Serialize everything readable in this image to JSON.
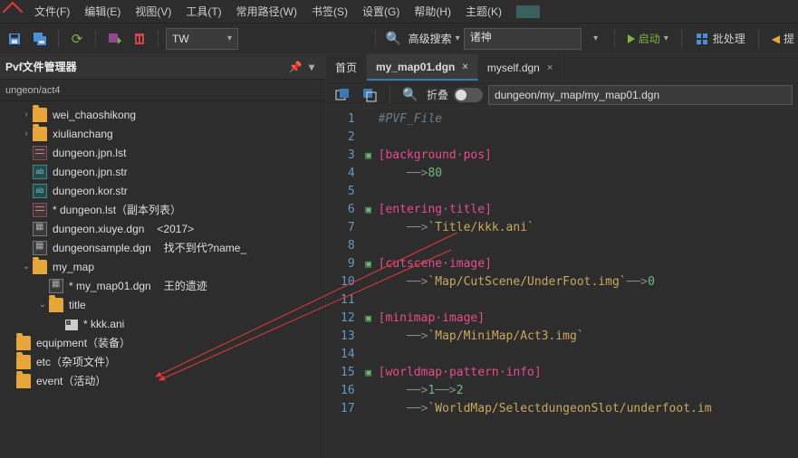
{
  "menu": {
    "items": [
      "文件(F)",
      "编辑(E)",
      "视图(V)",
      "工具(T)",
      "常用路径(W)",
      "书签(S)",
      "设置(G)",
      "帮助(H)",
      "主题(K)"
    ]
  },
  "toolbar": {
    "file_filter": "TW",
    "search_label": "高级搜索",
    "search_value": "诸神",
    "launch_label": "启动",
    "batch_label": "批处理",
    "prompt_label": "提"
  },
  "sidebar": {
    "title": "Pvf文件管理器",
    "crumb": "ungeon/act4",
    "tree": [
      {
        "indent": 1,
        "twisty": ">",
        "icon": "folder",
        "label": "wei_chaoshikong"
      },
      {
        "indent": 1,
        "twisty": ">",
        "icon": "folder",
        "label": "xiulianchang"
      },
      {
        "indent": 1,
        "twisty": "",
        "icon": "list",
        "label": "dungeon.jpn.lst"
      },
      {
        "indent": 1,
        "twisty": "",
        "icon": "str",
        "label": "dungeon.jpn.str"
      },
      {
        "indent": 1,
        "twisty": "",
        "icon": "str",
        "label": "dungeon.kor.str"
      },
      {
        "indent": 1,
        "twisty": "",
        "icon": "list",
        "label": "* dungeon.lst（副本列表）",
        "extra": ""
      },
      {
        "indent": 1,
        "twisty": "",
        "icon": "dgn",
        "label": "dungeon.xiuye.dgn",
        "extra": "<2017>"
      },
      {
        "indent": 1,
        "twisty": "",
        "icon": "dgn",
        "label": "dungeonsample.dgn",
        "extra": "找不到代?name_"
      },
      {
        "indent": 1,
        "twisty": "v",
        "icon": "folder",
        "label": "my_map"
      },
      {
        "indent": 2,
        "twisty": "",
        "icon": "dgn",
        "label": "* my_map01.dgn",
        "extra": "王的遗迹"
      },
      {
        "indent": 2,
        "twisty": "v",
        "icon": "folder",
        "label": "title"
      },
      {
        "indent": 3,
        "twisty": "",
        "icon": "ani",
        "label": "* kkk.ani"
      },
      {
        "indent": 0,
        "twisty": "",
        "icon": "folder",
        "label": "equipment（装备）"
      },
      {
        "indent": 0,
        "twisty": "",
        "icon": "folder",
        "label": "etc（杂项文件）"
      },
      {
        "indent": 0,
        "twisty": "",
        "icon": "folder",
        "label": "event（活动）"
      }
    ]
  },
  "editor": {
    "tabs": [
      {
        "label": "首页",
        "closable": false,
        "active": false
      },
      {
        "label": "my_map01.dgn",
        "closable": true,
        "active": true
      },
      {
        "label": "myself.dgn",
        "closable": true,
        "active": false
      }
    ],
    "fold_label": "折叠",
    "path": "dungeon/my_map/my_map01.dgn",
    "code": [
      {
        "n": 1,
        "tokens": [
          {
            "t": "tok-cmt",
            "v": "#PVF_File"
          }
        ]
      },
      {
        "n": 2,
        "tokens": []
      },
      {
        "n": 3,
        "fold": true,
        "tokens": [
          {
            "t": "tok-key",
            "v": "[background"
          },
          {
            "t": "tok-dot",
            "v": "·"
          },
          {
            "t": "tok-key",
            "v": "pos]"
          }
        ]
      },
      {
        "n": 4,
        "tokens": [
          {
            "t": "tok-arr",
            "v": "──>"
          },
          {
            "t": "tok-num",
            "v": "80"
          }
        ]
      },
      {
        "n": 5,
        "tokens": []
      },
      {
        "n": 6,
        "fold": true,
        "tokens": [
          {
            "t": "tok-key",
            "v": "[entering"
          },
          {
            "t": "tok-dot",
            "v": "·"
          },
          {
            "t": "tok-key",
            "v": "title]"
          }
        ]
      },
      {
        "n": 7,
        "tokens": [
          {
            "t": "tok-arr",
            "v": "──>"
          },
          {
            "t": "tok-str",
            "v": "`Title/kkk.ani`"
          }
        ]
      },
      {
        "n": 8,
        "tokens": []
      },
      {
        "n": 9,
        "fold": true,
        "tokens": [
          {
            "t": "tok-key",
            "v": "[cutscene"
          },
          {
            "t": "tok-dot",
            "v": "·"
          },
          {
            "t": "tok-key",
            "v": "image]"
          }
        ]
      },
      {
        "n": 10,
        "tokens": [
          {
            "t": "tok-arr",
            "v": "──>"
          },
          {
            "t": "tok-str",
            "v": "`Map/CutScene/UnderFoot.img`"
          },
          {
            "t": "tok-arr",
            "v": "──>"
          },
          {
            "t": "tok-num",
            "v": "0"
          }
        ]
      },
      {
        "n": 11,
        "tokens": []
      },
      {
        "n": 12,
        "fold": true,
        "tokens": [
          {
            "t": "tok-key",
            "v": "[minimap"
          },
          {
            "t": "tok-dot",
            "v": "·"
          },
          {
            "t": "tok-key",
            "v": "image]"
          }
        ]
      },
      {
        "n": 13,
        "tokens": [
          {
            "t": "tok-arr",
            "v": "──>"
          },
          {
            "t": "tok-str",
            "v": "`Map/MiniMap/Act3.img`"
          }
        ]
      },
      {
        "n": 14,
        "tokens": []
      },
      {
        "n": 15,
        "fold": true,
        "tokens": [
          {
            "t": "tok-key",
            "v": "[worldmap"
          },
          {
            "t": "tok-dot",
            "v": "·"
          },
          {
            "t": "tok-key",
            "v": "pattern"
          },
          {
            "t": "tok-dot",
            "v": "·"
          },
          {
            "t": "tok-key",
            "v": "info]"
          }
        ]
      },
      {
        "n": 16,
        "tokens": [
          {
            "t": "tok-arr",
            "v": "──>"
          },
          {
            "t": "tok-num",
            "v": "1"
          },
          {
            "t": "tok-arr",
            "v": "──>"
          },
          {
            "t": "tok-num",
            "v": "2"
          }
        ]
      },
      {
        "n": 17,
        "tokens": [
          {
            "t": "tok-arr",
            "v": "──>"
          },
          {
            "t": "tok-str",
            "v": "`WorldMap/SelectdungeonSlot/underfoot.im"
          }
        ]
      }
    ]
  }
}
